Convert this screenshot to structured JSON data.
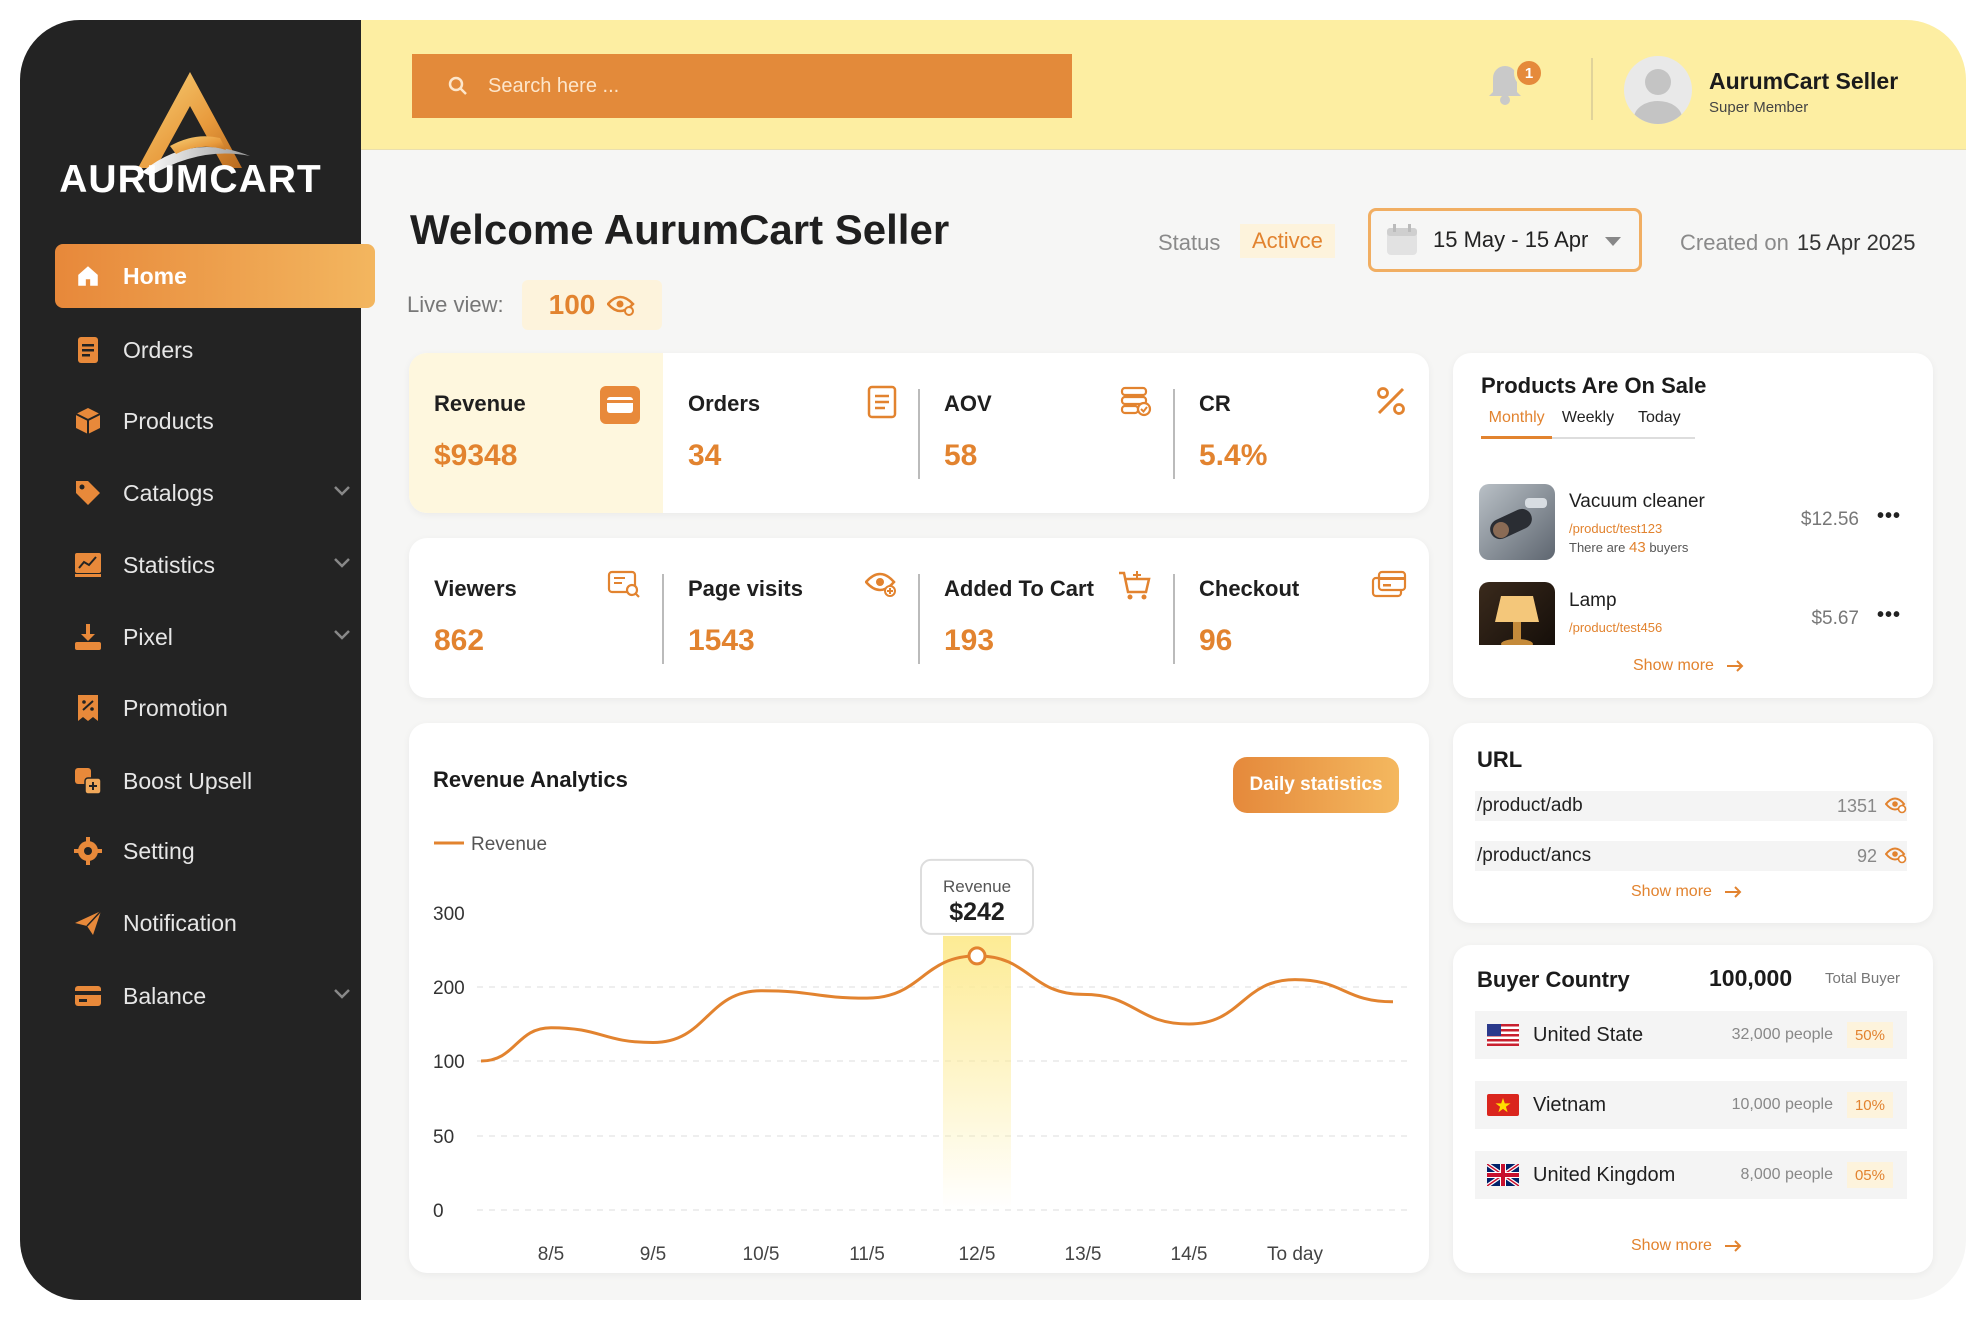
{
  "brand": {
    "name": "AURUMCART"
  },
  "sidebar": {
    "items": [
      {
        "label": "Home",
        "icon": "home-icon"
      },
      {
        "label": "Orders",
        "icon": "orders-icon"
      },
      {
        "label": "Products",
        "icon": "box-icon"
      },
      {
        "label": "Catalogs",
        "icon": "tag-icon"
      },
      {
        "label": "Statistics",
        "icon": "chart-icon"
      },
      {
        "label": "Pixel",
        "icon": "download-icon"
      },
      {
        "label": "Promotion",
        "icon": "promotion-icon"
      },
      {
        "label": "Boost Upsell",
        "icon": "upsell-icon"
      },
      {
        "label": "Setting",
        "icon": "gear-icon"
      },
      {
        "label": "Notification",
        "icon": "send-icon"
      },
      {
        "label": "Balance",
        "icon": "card-icon"
      }
    ]
  },
  "topbar": {
    "search_placeholder": "Search here ...",
    "notification_count": "1",
    "user_name": "AurumCart Seller",
    "user_role": "Super Member"
  },
  "header": {
    "welcome": "Welcome AurumCart Seller",
    "live_label": "Live view:",
    "live_value": "100",
    "status_label": "Status",
    "status_value": "Activce",
    "date_range": "15 May - 15 Apr",
    "created_label": "Created on",
    "created_value": "15 Apr 2025"
  },
  "metrics_top": [
    {
      "label": "Revenue",
      "value": "$9348"
    },
    {
      "label": "Orders",
      "value": "34"
    },
    {
      "label": "AOV",
      "value": "58"
    },
    {
      "label": "CR",
      "value": "5.4%"
    }
  ],
  "metrics_bottom": [
    {
      "label": "Viewers",
      "value": "862"
    },
    {
      "label": "Page visits",
      "value": "1543"
    },
    {
      "label": "Added To Cart",
      "value": "193"
    },
    {
      "label": "Checkout",
      "value": "96"
    }
  ],
  "analytics": {
    "title": "Revenue Analytics",
    "button": "Daily statistics",
    "legend": "Revenue",
    "tooltip_label": "Revenue",
    "tooltip_value": "$242"
  },
  "chart_data": {
    "type": "line",
    "title": "Revenue Analytics",
    "y_ticks": [
      "300",
      "200",
      "100",
      "50",
      "0"
    ],
    "x": [
      "8/5",
      "9/5",
      "10/5",
      "11/5",
      "12/5",
      "13/5",
      "14/5",
      "To day"
    ],
    "series": [
      {
        "name": "Revenue",
        "values": [
          145,
          125,
          195,
          185,
          242,
          190,
          150,
          210
        ]
      }
    ],
    "highlight": {
      "x": "12/5",
      "value": 242
    }
  },
  "products": {
    "title": "Products Are On Sale",
    "tabs": [
      "Monthly",
      "Weekly",
      "Today"
    ],
    "items": [
      {
        "name": "Vacuum cleaner",
        "url": "/product/test123",
        "buyers_prefix": "There are",
        "buyers_count": "43",
        "buyers_suffix": "buyers",
        "price": "$12.56"
      },
      {
        "name": "Lamp",
        "url": "/product/test456",
        "price": "$5.67"
      }
    ],
    "show_more": "Show more"
  },
  "urls": {
    "title": "URL",
    "items": [
      {
        "path": "/product/adb",
        "count": "1351"
      },
      {
        "path": "/product/ancs",
        "count": "92"
      }
    ],
    "show_more": "Show more"
  },
  "buyers": {
    "title": "Buyer Country",
    "total": "100,000",
    "total_label": "Total Buyer",
    "items": [
      {
        "country": "United State",
        "people": "32,000 people",
        "pct": "50%"
      },
      {
        "country": "Vietnam",
        "people": "10,000 people",
        "pct": "10%"
      },
      {
        "country": "United Kingdom",
        "people": "8,000 people",
        "pct": "05%"
      }
    ],
    "show_more": "Show more"
  },
  "colors": {
    "accent": "#e2832f",
    "sidebar": "#232323",
    "topbar": "#fdeea2"
  }
}
